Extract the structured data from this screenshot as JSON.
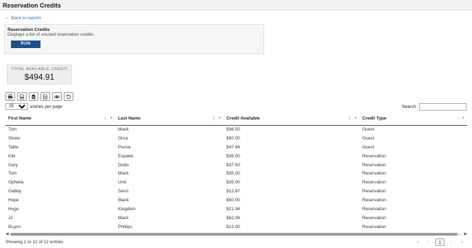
{
  "page": {
    "title": "Reservation Credits"
  },
  "nav": {
    "back_label": "← Back to reports"
  },
  "report": {
    "title": "Reservation Credits",
    "description": "Displays a list of unused reservation credits.",
    "run_label": "RUN"
  },
  "summary": {
    "label": "TOTAL AVAILABLE CREDIT",
    "value": "$494.91"
  },
  "toolbar": {
    "icons": [
      "print-icon",
      "csv-icon",
      "excel-icon",
      "pdf-icon",
      "eye-icon",
      "reset-icon"
    ]
  },
  "length": {
    "value": "25",
    "suffix": "entries per page"
  },
  "search": {
    "label": "Search:",
    "value": ""
  },
  "table": {
    "columns": [
      "First Name",
      "Last Name",
      "Credit Available",
      "Credit Type"
    ],
    "rows": [
      [
        "Tom",
        "Mack",
        "$96.50",
        "Guest"
      ],
      [
        "Stone",
        "Orca",
        "$50.00",
        "Guest"
      ],
      [
        "Tallie",
        "Poosa",
        "$47.64",
        "Guest"
      ],
      [
        "Kiki",
        "Espada",
        "$35.00",
        "Reservation"
      ],
      [
        "Gary",
        "Dodo",
        "$37.50",
        "Reservation"
      ],
      [
        "Tom",
        "Mack",
        "$35.00",
        "Reservation"
      ],
      [
        "Ophelia",
        "Und",
        "$35.00",
        "Reservation"
      ],
      [
        "Gabby",
        "Senn",
        "$12.87",
        "Reservation"
      ],
      [
        "Hope",
        "Black",
        "$50.00",
        "Reservation"
      ],
      [
        "Hugo",
        "Kingdom",
        "$21.34",
        "Reservation"
      ],
      [
        "JJ",
        "Mack",
        "$62.06",
        "Reservation"
      ],
      [
        "BLynn",
        "Phillips",
        "$12.00",
        "Reservation"
      ]
    ]
  },
  "footer": {
    "info": "Showing 1 to 12 of 12 entries",
    "pager": {
      "first": "«",
      "prev": "‹",
      "current": "1",
      "next": "›",
      "last": "»"
    }
  }
}
